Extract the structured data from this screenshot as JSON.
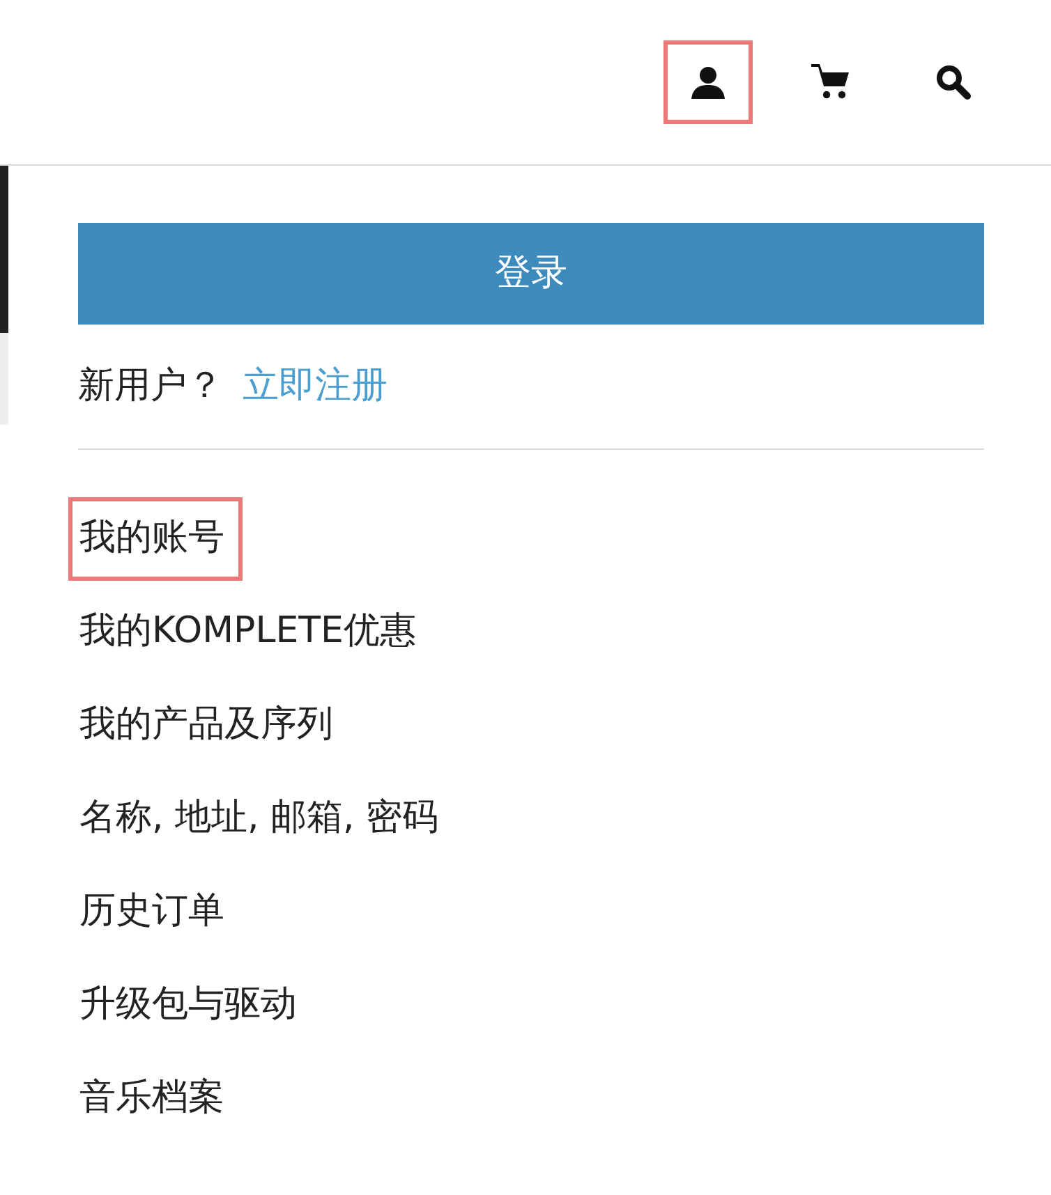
{
  "header": {
    "icons": [
      {
        "kind": "user",
        "highlighted": true
      },
      {
        "kind": "cart",
        "highlighted": false
      },
      {
        "kind": "search",
        "highlighted": false
      }
    ]
  },
  "dropdown": {
    "login_button": "登录",
    "signup_prompt": "新用户？",
    "signup_link": "立即注册",
    "menu": [
      {
        "label": "我的账号",
        "highlighted": true
      },
      {
        "label": "我的KOMPLETE优惠",
        "highlighted": false
      },
      {
        "label": "我的产品及序列",
        "highlighted": false
      },
      {
        "label": "名称, 地址, 邮箱, 密码",
        "highlighted": false
      },
      {
        "label": "历史订单",
        "highlighted": false
      },
      {
        "label": "升级包与驱动",
        "highlighted": false
      },
      {
        "label": "音乐档案",
        "highlighted": false
      }
    ]
  }
}
